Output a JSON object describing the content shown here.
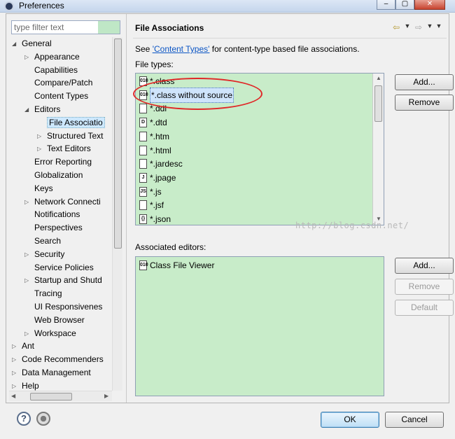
{
  "window": {
    "title": "Preferences",
    "minimize": "–",
    "maximize": "▢",
    "close": "✕"
  },
  "filter": {
    "placeholder": "type filter text"
  },
  "tree": [
    {
      "label": "General",
      "expander": "◢"
    },
    {
      "label": "Appearance",
      "expander": "▷"
    },
    {
      "label": "Capabilities",
      "expander": ""
    },
    {
      "label": "Compare/Patch",
      "expander": ""
    },
    {
      "label": "Content Types",
      "expander": ""
    },
    {
      "label": "Editors",
      "expander": "◢"
    },
    {
      "label": "File Associatio",
      "expander": ""
    },
    {
      "label": "Structured Text",
      "expander": "▷"
    },
    {
      "label": "Text Editors",
      "expander": "▷"
    },
    {
      "label": "Error Reporting",
      "expander": ""
    },
    {
      "label": "Globalization",
      "expander": ""
    },
    {
      "label": "Keys",
      "expander": ""
    },
    {
      "label": "Network Connecti",
      "expander": "▷"
    },
    {
      "label": "Notifications",
      "expander": ""
    },
    {
      "label": "Perspectives",
      "expander": ""
    },
    {
      "label": "Search",
      "expander": ""
    },
    {
      "label": "Security",
      "expander": "▷"
    },
    {
      "label": "Service Policies",
      "expander": ""
    },
    {
      "label": "Startup and Shutd",
      "expander": "▷"
    },
    {
      "label": "Tracing",
      "expander": ""
    },
    {
      "label": "UI Responsivenes",
      "expander": ""
    },
    {
      "label": "Web Browser",
      "expander": ""
    },
    {
      "label": "Workspace",
      "expander": "▷"
    },
    {
      "label": "Ant",
      "expander": "▷"
    },
    {
      "label": "Code Recommenders",
      "expander": "▷"
    },
    {
      "label": "Data Management",
      "expander": "▷"
    },
    {
      "label": "Help",
      "expander": "▷"
    }
  ],
  "page": {
    "title": "File Associations",
    "see_prefix": "See ",
    "see_link": "'Content Types'",
    "see_suffix": " for content-type based file associations.",
    "file_types_label": "File types:",
    "associated_editors_label": "Associated editors:"
  },
  "file_types": [
    {
      "label": "*.class",
      "icon": "010"
    },
    {
      "label": "*.class without source",
      "icon": "010"
    },
    {
      "label": "*.ddl",
      "icon": ""
    },
    {
      "label": "*.dtd",
      "icon": "D"
    },
    {
      "label": "*.htm",
      "icon": ""
    },
    {
      "label": "*.html",
      "icon": ""
    },
    {
      "label": "*.jardesc",
      "icon": ""
    },
    {
      "label": "*.jpage",
      "icon": "J"
    },
    {
      "label": "*.js",
      "icon": "JS"
    },
    {
      "label": "*.jsf",
      "icon": ""
    },
    {
      "label": "*.json",
      "icon": "{}"
    }
  ],
  "editors": [
    {
      "label": "Class File Viewer",
      "icon": "010"
    }
  ],
  "watermark": "http://blog.csdn.net/",
  "buttons": {
    "add_types": "Add...",
    "remove_types": "Remove",
    "add_editor": "Add...",
    "remove_editor": "Remove",
    "default": "Default",
    "ok": "OK",
    "cancel": "Cancel"
  },
  "icons": {
    "help": "?",
    "nav_back": "⇦",
    "nav_forward": "⇨",
    "menu": "▼"
  }
}
